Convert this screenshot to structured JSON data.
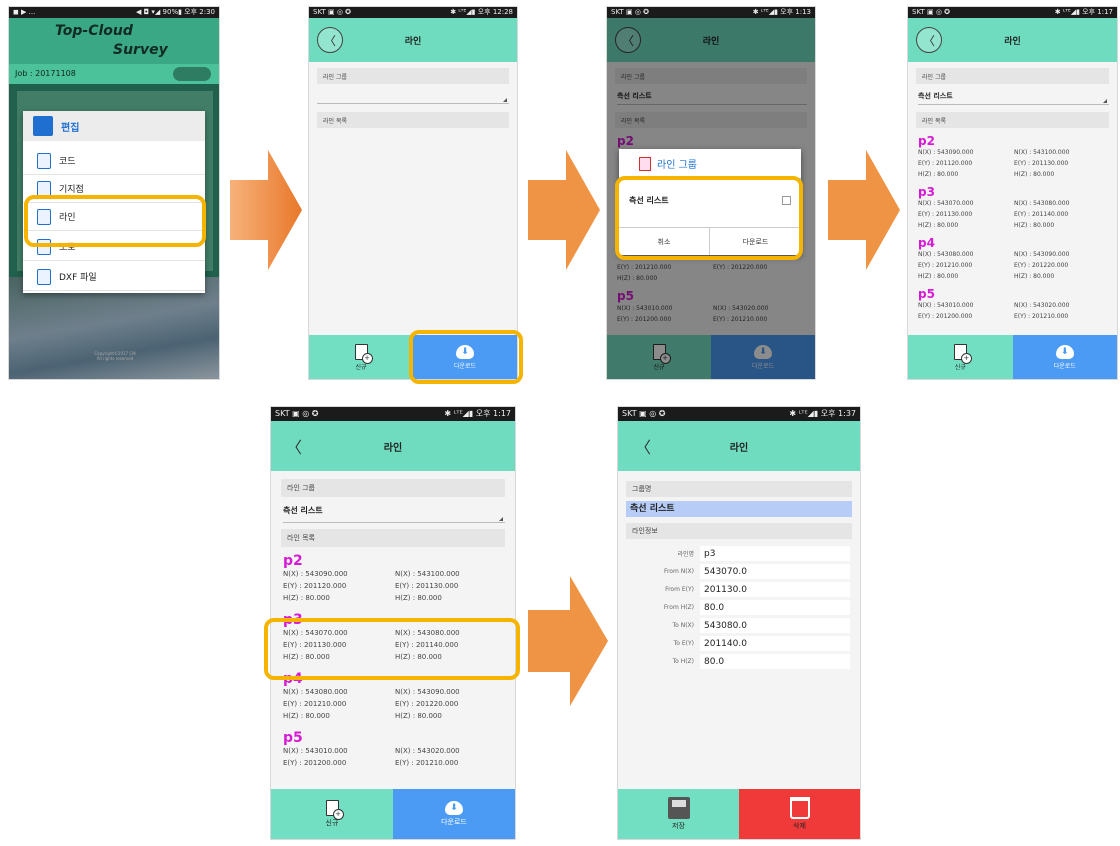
{
  "status_bar": {
    "p1_left": "◼ ▶ ...",
    "p1_right": "◀ ◘ ▾◢ 90%▮ 오후 2:30",
    "p2_left": "SKT ▣ ◎ ✪",
    "p2_right": "✱ ᴸᵀᴱ◢▮ 오후 12:28",
    "p3_left": "SKT ▣ ◎ ✪",
    "p3_right": "✱ ᴸᵀᴱ◢▮ 오후 1:13",
    "p4_left": "SKT ▣ ◎ ✪",
    "p4_right": "✱ ᴸᵀᴱ◢▮ 오후 1:17",
    "p5_left": "SKT ▣ ◎ ✪",
    "p5_right": "✱ ᴸᵀᴱ◢▮ 오후 1:17",
    "p6_left": "SKT ▣ ◎ ✪",
    "p6_right": "✱ ᴸᵀᴱ◢▮ 오후 1:37"
  },
  "app": {
    "title_line1": "Top-Cloud",
    "title_line2": "Survey",
    "job": "Job : 20171108",
    "copyright": "Copyright©2017 CM\nAll rights reserved"
  },
  "menu": {
    "header": "편집",
    "items": [
      "코드",
      "기지점",
      "라인",
      "도로",
      "DXF 파일"
    ]
  },
  "header": {
    "title": "라인",
    "back": "〈"
  },
  "labels": {
    "line_group": "라인 그룹",
    "line_list": "라인 목록",
    "selected_group": "측선 리스트"
  },
  "footer": {
    "new": "신규",
    "download": "다운로드",
    "save": "저장",
    "delete": "삭제"
  },
  "dialog": {
    "title": "라인 그룹",
    "item": "측선 리스트",
    "cancel": "취소",
    "download": "다운로드"
  },
  "points": [
    {
      "name": "p2",
      "n": "N(X) : 543090.000",
      "e": "E(Y) : 201120.000",
      "h": "H(Z) : 80.000",
      "n2": "N(X) : 543100.000",
      "e2": "E(Y) : 201130.000",
      "h2": "H(Z) : 80.000"
    },
    {
      "name": "p3",
      "n": "N(X) : 543070.000",
      "e": "E(Y) : 201130.000",
      "h": "H(Z) : 80.000",
      "n2": "N(X) : 543080.000",
      "e2": "E(Y) : 201140.000",
      "h2": "H(Z) : 80.000"
    },
    {
      "name": "p4",
      "n": "N(X) : 543080.000",
      "e": "E(Y) : 201210.000",
      "h": "H(Z) : 80.000",
      "n2": "N(X) : 543090.000",
      "e2": "E(Y) : 201220.000",
      "h2": "H(Z) : 80.000"
    },
    {
      "name": "p5",
      "n": "N(X) : 543010.000",
      "e": "E(Y) : 201200.000",
      "h": "",
      "n2": "N(X) : 543020.000",
      "e2": "E(Y) : 201210.000",
      "h2": ""
    }
  ],
  "detail": {
    "group_label": "그룹명",
    "group_value": "측선 리스트",
    "info_label": "라인정보",
    "rows": [
      {
        "label": "라인명",
        "value": "p3"
      },
      {
        "label": "From N(X)",
        "value": "543070.0"
      },
      {
        "label": "From E(Y)",
        "value": "201130.0"
      },
      {
        "label": "From H(Z)",
        "value": "80.0"
      },
      {
        "label": "To N(X)",
        "value": "543080.0"
      },
      {
        "label": "To E(Y)",
        "value": "201140.0"
      },
      {
        "label": "To H(Z)",
        "value": "80.0"
      }
    ]
  },
  "colors": {
    "mint": "#73dfc2",
    "blue": "#4b9bf4",
    "red": "#f03a3a",
    "highlight": "#f5b400",
    "arrow": "#f08a2a",
    "point_name": "#d51bd5"
  }
}
